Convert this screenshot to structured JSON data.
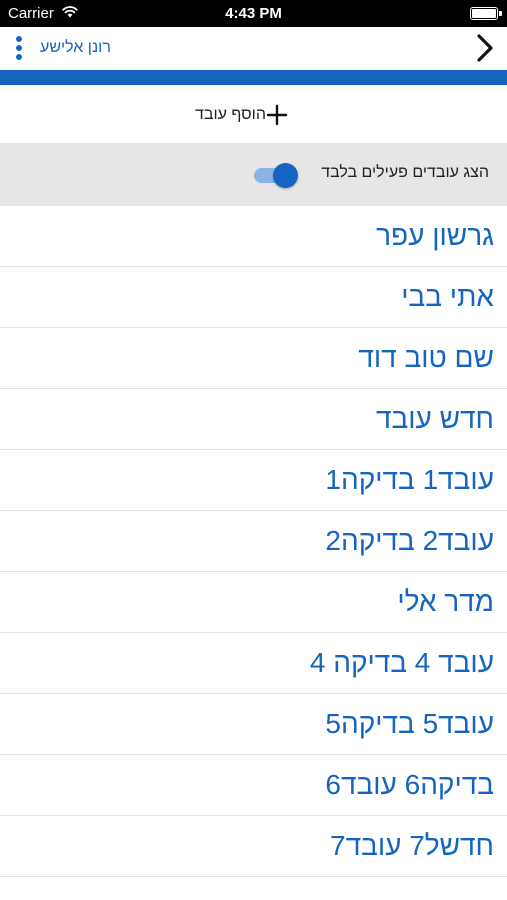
{
  "status_bar": {
    "carrier": "Carrier",
    "time": "4:43 PM",
    "icons": [
      "wifi-icon",
      "battery-icon"
    ]
  },
  "header": {
    "user_name": "רונן אלישע",
    "menu_icon": "more-vertical-icon",
    "back_icon": "chevron-right-icon"
  },
  "actions": {
    "add_employee_label": "הוסף עובד",
    "add_icon": "plus-icon"
  },
  "filter": {
    "label": "הצג עובדים פעילים בלבד",
    "toggle_on": true
  },
  "employees": [
    "גרשון עפר",
    "אתי בבי",
    "שם טוב דוד",
    "חדש עובד",
    "עובד1 בדיקה1",
    "עובד2 בדיקה2",
    "מדר אלי",
    "עובד 4 בדיקה 4",
    "עובד5 בדיקה5",
    "בדיקה6 עובד6",
    "חדשל7 עובד7"
  ],
  "colors": {
    "accent": "#1565c0",
    "toggle_track": "#8ab4e6",
    "filter_background": "#e6e6e6",
    "status_bar": "#000000"
  }
}
